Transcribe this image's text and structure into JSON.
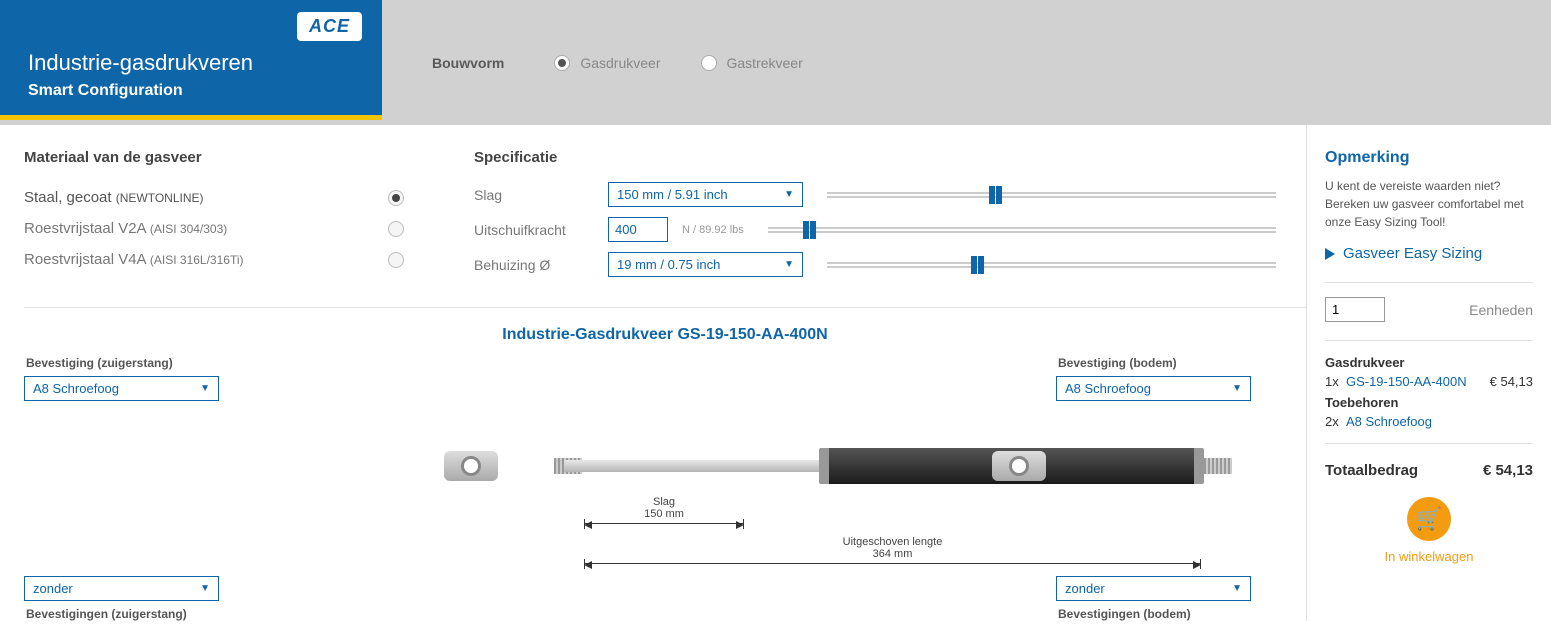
{
  "header": {
    "logo": "ACE",
    "title": "Industrie-gasdrukveren",
    "subtitle": "Smart Configuration"
  },
  "bouwvorm": {
    "label": "Bouwvorm",
    "options": [
      {
        "label": "Gasdrukveer",
        "checked": true
      },
      {
        "label": "Gastrekveer",
        "checked": false
      }
    ]
  },
  "material": {
    "heading": "Materiaal van de gasveer",
    "options": [
      {
        "label": "Staal, gecoat ",
        "note": "(NEWTONLINE)",
        "checked": true
      },
      {
        "label": "Roestvrijstaal V2A ",
        "note": "(AISI 304/303)",
        "checked": false
      },
      {
        "label": "Roestvrijstaal V4A ",
        "note": "(AISI 316L/316Ti)",
        "checked": false
      }
    ]
  },
  "spec": {
    "heading": "Specificatie",
    "rows": {
      "slag": {
        "label": "Slag",
        "value": "150 mm / 5.91 inch",
        "slider_pos": "36%"
      },
      "uitschuifkracht": {
        "label": "Uitschuifkracht",
        "value": "400",
        "unit": "N / 89.92 lbs",
        "slider_pos": "7%"
      },
      "behuizing": {
        "label": "Behuizing Ø",
        "value": "19 mm / 0.75 inch",
        "slider_pos": "32%"
      }
    }
  },
  "product_title": "Industrie-Gasdrukveer GS-19-150-AA-400N",
  "fitting": {
    "left_label": "Bevestiging (zuigerstang)",
    "left_value": "A8 Schroefoog",
    "right_label": "Bevestiging (bodem)",
    "right_value": "A8 Schroefoog",
    "bottom_left_value": "zonder",
    "bottom_left_label": "Bevestigingen (zuigerstang)",
    "bottom_right_value": "zonder",
    "bottom_right_label": "Bevestigingen (bodem)"
  },
  "diagram": {
    "slag_label": "Slag",
    "slag_value": "150 mm",
    "len_label": "Uitgeschoven lengte",
    "len_value": "364 mm"
  },
  "side": {
    "opmerking_heading": "Opmerking",
    "opmerking_text": "U kent de vereiste waarden niet? Bereken uw gasveer comfortabel met onze Easy Sizing Tool!",
    "easy_link": "Gasveer Easy Sizing",
    "qty_value": "1",
    "qty_label": "Eenheden",
    "cart": {
      "sec1": "Gasdrukveer",
      "line1_qty": "1x",
      "line1_name": "GS-19-150-AA-400N",
      "line1_price": "€ 54,13",
      "sec2": "Toebehoren",
      "line2_qty": "2x",
      "line2_name": "A8 Schroefoog"
    },
    "total_label": "Totaalbedrag",
    "total_value": "€ 54,13",
    "cart_button_text": "In winkelwagen"
  }
}
